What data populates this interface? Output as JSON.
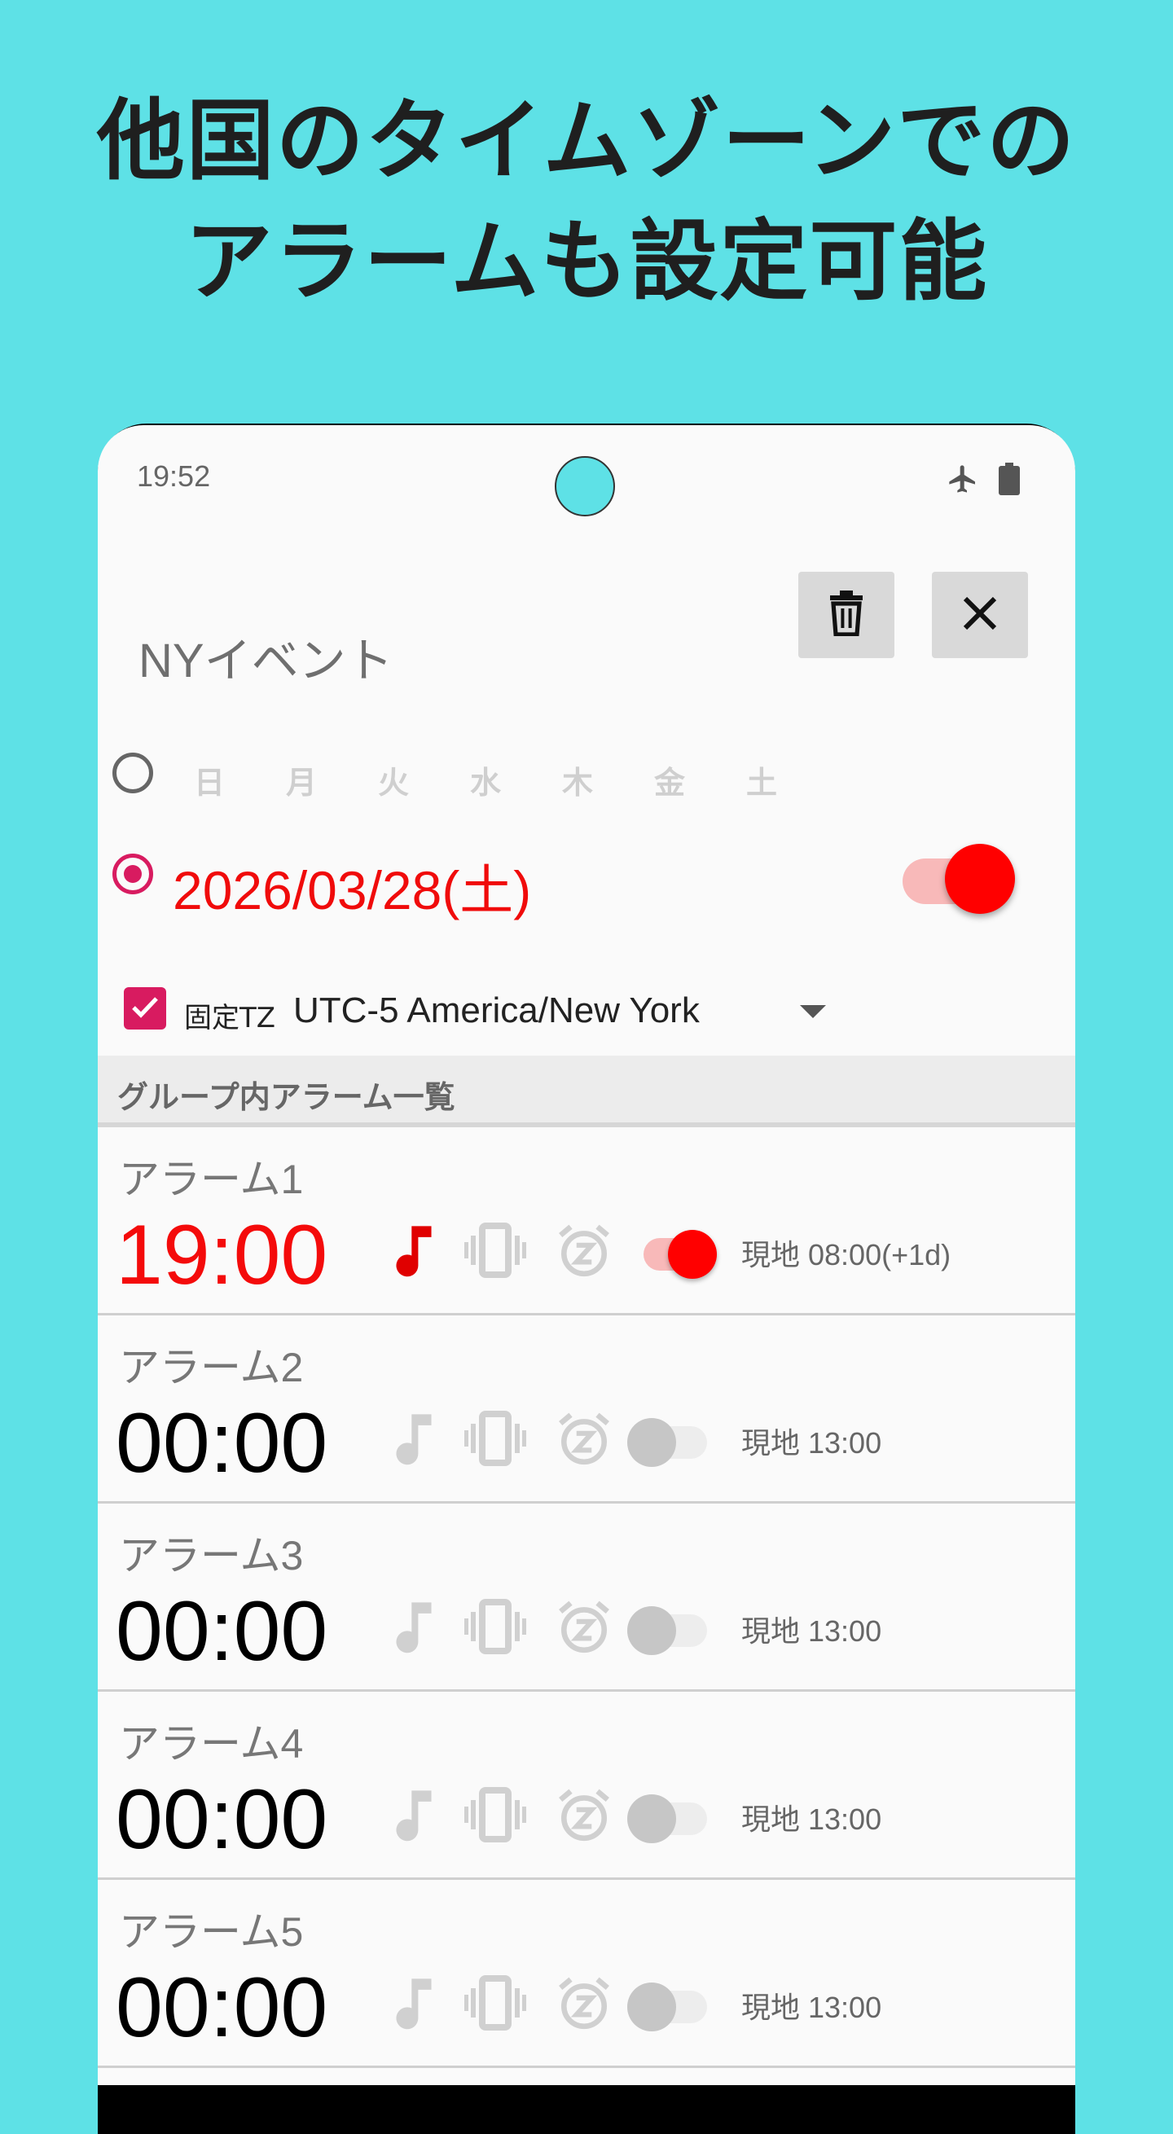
{
  "headline": {
    "line1": "他国のタイムゾーンでの",
    "line2": "アラームも設定可能"
  },
  "status_bar": {
    "time": "19:52",
    "icons": [
      "airplane-icon",
      "battery-icon"
    ]
  },
  "header": {
    "event_title": "NYイベント",
    "delete_icon": "trash-icon",
    "close_icon": "close-icon"
  },
  "weekdays": {
    "selected": false,
    "days": [
      "日",
      "月",
      "火",
      "水",
      "木",
      "金",
      "土"
    ]
  },
  "date": {
    "selected": true,
    "value": "2026/03/28(土)",
    "enabled": true
  },
  "timezone": {
    "fixed_checked": true,
    "label": "固定TZ",
    "value": "UTC-5 America/New York"
  },
  "section": {
    "title": "グループ内アラーム一覧"
  },
  "alarms": [
    {
      "name": "アラーム1",
      "time": "19:00",
      "enabled": true,
      "sound": true,
      "local": "現地 08:00(+1d)"
    },
    {
      "name": "アラーム2",
      "time": "00:00",
      "enabled": false,
      "sound": false,
      "local": "現地 13:00"
    },
    {
      "name": "アラーム3",
      "time": "00:00",
      "enabled": false,
      "sound": false,
      "local": "現地 13:00"
    },
    {
      "name": "アラーム4",
      "time": "00:00",
      "enabled": false,
      "sound": false,
      "local": "現地 13:00"
    },
    {
      "name": "アラーム5",
      "time": "00:00",
      "enabled": false,
      "sound": false,
      "local": "現地 13:00"
    }
  ],
  "colors": {
    "background": "#5ee1e6",
    "accent_red": "#ff0000",
    "accent_pink": "#d81b60",
    "disabled_icon": "#d0d0d0"
  }
}
